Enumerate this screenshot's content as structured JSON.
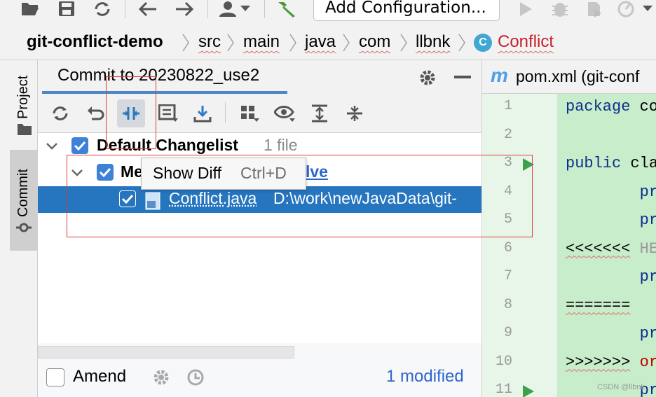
{
  "toolbar": {
    "config_label": "Add Configuration...",
    "icons": [
      "open-folder-icon",
      "save-icon",
      "sync-icon",
      "back-icon",
      "forward-icon",
      "user-icon",
      "chevron-down-icon",
      "build-hammer-icon",
      "run-icon",
      "debug-icon",
      "coverage-icon",
      "profiler-icon",
      "more-icon"
    ]
  },
  "breadcrumb": {
    "items": [
      "git-conflict-demo",
      "src",
      "main",
      "java",
      "com",
      "llbnk",
      "Conflict"
    ],
    "class_badge": "C"
  },
  "left_strip": {
    "tabs": [
      "Project",
      "Commit"
    ]
  },
  "commit_panel": {
    "title": "Commit to 20230822_use2",
    "tree": {
      "changelist_name": "Default Changelist",
      "changelist_count": "1 file",
      "group_prefix": "Me",
      "group_suffix": "lve",
      "file_name": "Conflict.java",
      "file_path": "D:\\work\\newJavaData\\git-"
    },
    "bottom": {
      "amend_label": "Amend",
      "modified_link": "1 modified"
    }
  },
  "tooltip": {
    "label": "Show Diff",
    "shortcut": "Ctrl+D"
  },
  "editor": {
    "tab_icon": "m",
    "tab_label": "pom.xml (git-conf",
    "lines": [
      {
        "num": "1",
        "code": "package co"
      },
      {
        "num": "2",
        "code": ""
      },
      {
        "num": "3",
        "code": "public cla"
      },
      {
        "num": "4",
        "code": "        pr"
      },
      {
        "num": "5",
        "code": "        pr"
      },
      {
        "num": "6",
        "code": "<<<<<<< HE"
      },
      {
        "num": "7",
        "code": "        pr"
      },
      {
        "num": "8",
        "code": "======="
      },
      {
        "num": "9",
        "code": "        pr"
      },
      {
        "num": "10",
        "code": ">>>>>>> or"
      },
      {
        "num": "11",
        "code": "        pr"
      }
    ]
  },
  "watermark": "CSDN @llbnk",
  "colors": {
    "selection": "#2675bf",
    "checkbox": "#3d82d6",
    "link": "#2f65ca",
    "code_bg": "#c8edcb",
    "gutter_bg": "#e8f6e9",
    "annotation": "#e03a3a"
  }
}
